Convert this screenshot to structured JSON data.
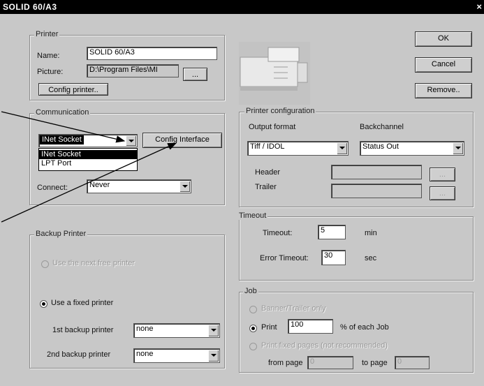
{
  "window": {
    "title": "SOLID 60/A3",
    "close_glyph": "×"
  },
  "buttons": {
    "ok": "OK",
    "cancel": "Cancel",
    "remove": "Remove..",
    "config_printer": "Config printer..",
    "config_interface": "Config Interface",
    "browse": "...",
    "header_browse": "...",
    "trailer_browse": "..."
  },
  "printer": {
    "group_label": "Printer",
    "name_label": "Name:",
    "name_value": "SOLID 60/A3",
    "picture_label": "Picture:",
    "picture_value": "D:\\Program Files\\MI"
  },
  "communication": {
    "group_label": "Communication",
    "selected": "INet Socket",
    "options": [
      "INet Socket",
      "LPT Port"
    ],
    "connect_label": "Connect:",
    "connect_value": "Never"
  },
  "printer_configuration": {
    "group_label": "Printer configuration",
    "output_format_label": "Output format",
    "output_format_value": "Tiff / IDOL",
    "backchannel_label": "Backchannel",
    "backchannel_value": "Status Out",
    "header_label": "Header",
    "header_value": "",
    "trailer_label": "Trailer",
    "trailer_value": ""
  },
  "timeout": {
    "group_label": "Timeout",
    "timeout_label": "Timeout:",
    "timeout_value": "5",
    "timeout_unit": "min",
    "error_timeout_label": "Error Timeout:",
    "error_timeout_value": "30",
    "error_timeout_unit": "sec"
  },
  "backup_printer": {
    "group_label": "Backup Printer",
    "option_disabled": "Use the next free printer",
    "option_fixed": "Use a fixed printer",
    "first_label": "1st backup printer",
    "first_value": "none",
    "second_label": "2nd backup printer",
    "second_value": "none"
  },
  "job": {
    "group_label": "Job",
    "option_banner": "Banner/Trailer only",
    "option_print": "Print",
    "print_value": "100",
    "print_suffix": "% of each Job",
    "option_fixed_pages": "Print fixed pages (not recommended)",
    "from_page_label": "from page",
    "from_page_value": "0",
    "to_page_label": "to page",
    "to_page_value": "0"
  },
  "colors": {
    "dialog_bg": "#c8c8c8",
    "titlebar_bg": "#000000",
    "selection_bg": "#000000"
  },
  "icons": {
    "printer_picture": "printer-picture-icon"
  }
}
